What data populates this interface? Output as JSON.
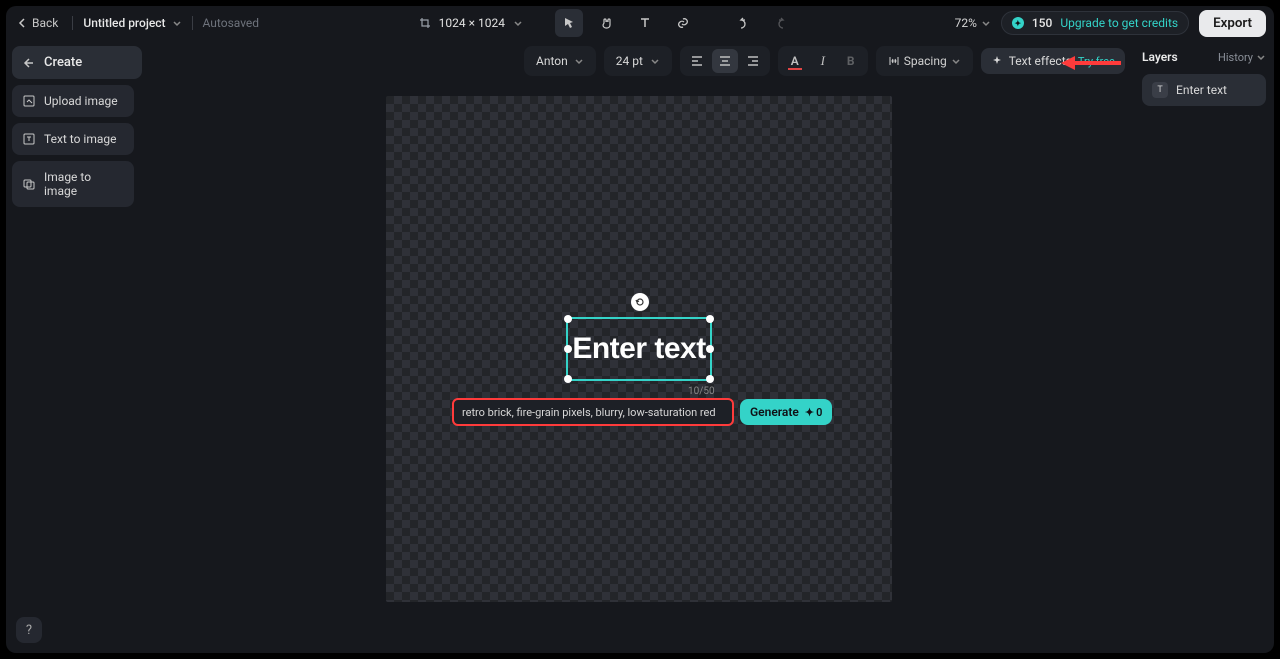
{
  "topbar": {
    "back": "Back",
    "project_name": "Untitled project",
    "autosaved": "Autosaved",
    "dimensions": "1024 × 1024",
    "zoom": "72%",
    "credits": "150",
    "upgrade": "Upgrade to get credits",
    "export": "Export"
  },
  "sidebar": {
    "create": "Create",
    "upload_image": "Upload image",
    "text_to_image": "Text to image",
    "image_to_image": "Image to image"
  },
  "toolbar": {
    "font": "Anton",
    "size": "24 pt",
    "spacing": "Spacing",
    "text_effects": "Text effects",
    "try_free": "Try free"
  },
  "canvas": {
    "text_content": "Enter text",
    "char_count": "10/50",
    "prompt_value": "retro brick, fire-grain pixels, blurry, low-saturation red",
    "generate": "Generate",
    "gen_cost": "0"
  },
  "layers": {
    "tab_layers": "Layers",
    "tab_history": "History",
    "item1": "Enter text"
  }
}
